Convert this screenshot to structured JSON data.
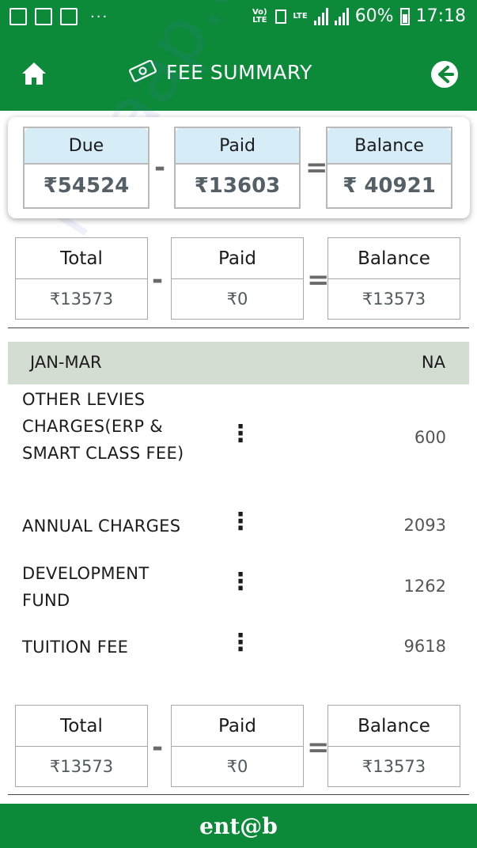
{
  "status_bar": {
    "battery": "60%",
    "time": "17:18",
    "network": "LTE",
    "volte": "Vo) LTE",
    "more": "···"
  },
  "header": {
    "title": "FEE SUMMARY"
  },
  "summary": {
    "due_label": "Due",
    "due_value": "₹54524",
    "paid_label": "Paid",
    "paid_value": "₹13603",
    "balance_label": "Balance",
    "balance_value": "₹ 40921",
    "minus": "-",
    "equals": "="
  },
  "totals_top": {
    "total_label": "Total",
    "total_value": "₹13573",
    "paid_label": "Paid",
    "paid_value": "₹0",
    "balance_label": "Balance",
    "balance_value": "₹13573"
  },
  "quarter": {
    "name": "JAN-MAR",
    "status": "NA"
  },
  "items": [
    {
      "name": "OTHER LEVIES CHARGES(ERP & SMART CLASS FEE)",
      "amount": "600"
    },
    {
      "name": "ANNUAL CHARGES",
      "amount": "2093"
    },
    {
      "name": "DEVELOPMENT FUND",
      "amount": "1262"
    },
    {
      "name": "TUITION FEE",
      "amount": "9618"
    }
  ],
  "totals_bottom": {
    "total_label": "Total",
    "total_value": "₹13573",
    "paid_label": "Paid",
    "paid_value": "₹0",
    "balance_label": "Balance",
    "balance_value": "₹13573"
  },
  "footer": {
    "brand": "ent@b"
  },
  "watermark": "milaap.org/MIL8507",
  "colors": {
    "primary_green": "#0c8a3a",
    "header_blue": "#d6ecf7",
    "band_grey_green": "#d3ddd2"
  }
}
